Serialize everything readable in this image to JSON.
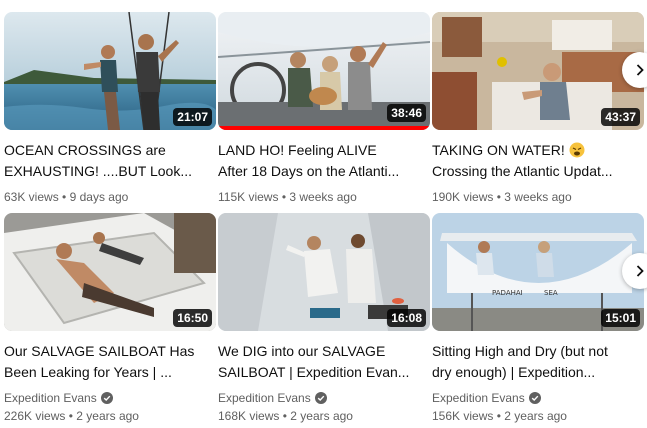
{
  "videos": [
    {
      "title_line1": "OCEAN CROSSINGS are",
      "title_line2": "EXHAUSTING! ....BUT Look...",
      "duration": "21:07",
      "views": "63K views",
      "age": "9 days ago",
      "channel": ""
    },
    {
      "title_line1": "LAND HO! Feeling ALIVE",
      "title_line2": "After 18 Days on the Atlanti...",
      "duration": "38:46",
      "views": "115K views",
      "age": "3 weeks ago",
      "channel": "",
      "watched_fraction": 1.0
    },
    {
      "title_line1": "TAKING ON WATER!",
      "title_line2": "Crossing the Atlantic Updat...",
      "duration": "43:37",
      "views": "190K views",
      "age": "3 weeks ago",
      "channel": ""
    },
    {
      "title_line1": "Our SALVAGE SAILBOAT Has",
      "title_line2": "Been Leaking for Years | ...",
      "duration": "16:50",
      "views": "226K views",
      "age": "2 years ago",
      "channel": "Expedition Evans"
    },
    {
      "title_line1": "We DIG into our SALVAGE",
      "title_line2": "SAILBOAT | Expedition Evan...",
      "duration": "16:08",
      "views": "168K views",
      "age": "2 years ago",
      "channel": "Expedition Evans"
    },
    {
      "title_line1": "Sitting High and Dry (but not",
      "title_line2": "dry enough) | Expedition...",
      "duration": "15:01",
      "views": "156K views",
      "age": "2 years ago",
      "channel": "Expedition Evans"
    }
  ],
  "separator": "•",
  "icons": {
    "verified": "verified-check-icon",
    "next": "chevron-right-icon",
    "emoji": "distressed-face-emoji"
  },
  "colors": {
    "progress": "#ff0000",
    "meta_text": "#606060",
    "title_text": "#0f0f0f"
  }
}
